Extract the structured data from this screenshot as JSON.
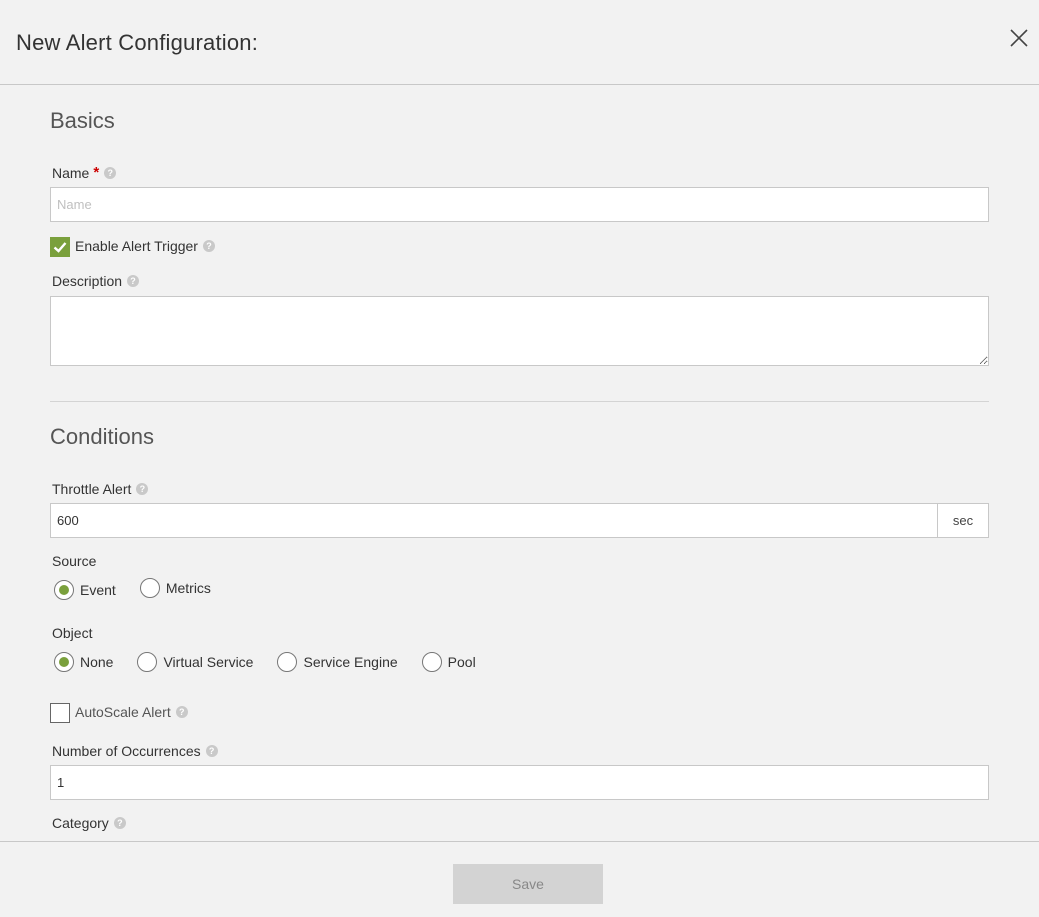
{
  "header": {
    "title": "New Alert Configuration:"
  },
  "basics": {
    "title": "Basics",
    "name_label": "Name",
    "required_mark": "*",
    "name_placeholder": "Name",
    "name_value": "",
    "enable_trigger_label": "Enable Alert Trigger",
    "enable_trigger_checked": true,
    "description_label": "Description",
    "description_value": ""
  },
  "conditions": {
    "title": "Conditions",
    "throttle_label": "Throttle Alert",
    "throttle_value": "600",
    "throttle_unit": "sec",
    "source_label": "Source",
    "source_options": [
      "Event",
      "Metrics"
    ],
    "source_selected": "Event",
    "object_label": "Object",
    "object_options": [
      "None",
      "Virtual Service",
      "Service Engine",
      "Pool"
    ],
    "object_selected": "None",
    "autoscale_label": "AutoScale Alert",
    "autoscale_checked": false,
    "occurrences_label": "Number of Occurrences",
    "occurrences_value": "1",
    "category_label": "Category"
  },
  "footer": {
    "save_label": "Save"
  },
  "colors": {
    "accent": "#7aa03c",
    "required": "#cc0000",
    "disabled_button": "#d3d3d3"
  },
  "icons": {
    "close": "close-icon",
    "help": "help-icon",
    "check": "check-icon"
  }
}
